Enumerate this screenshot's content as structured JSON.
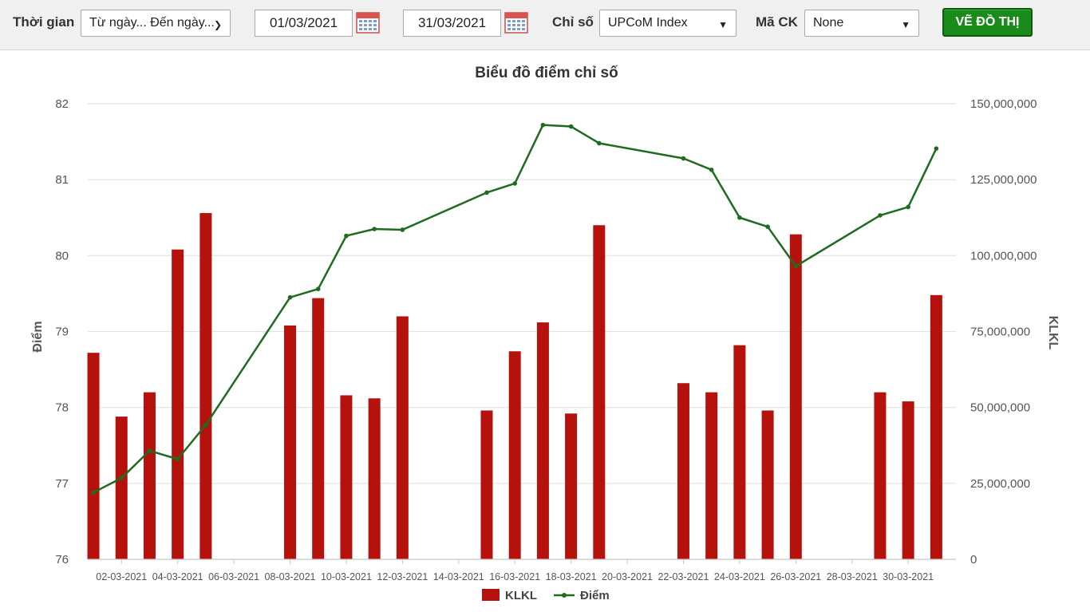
{
  "toolbar": {
    "time_label": "Thời gian",
    "time_range_value": "Từ ngày... Đến ngày...",
    "from_date": "01/03/2021",
    "to_date": "31/03/2021",
    "index_label": "Chỉ số",
    "index_value": "UPCoM Index",
    "stock_label": "Mã CK",
    "stock_value": "None",
    "draw_button": "VẼ ĐỒ THỊ"
  },
  "colors": {
    "bar": "#b5120e",
    "line": "#1f6b1f",
    "grid": "#e2e2e2",
    "axis_text": "#555555"
  },
  "chart_data": {
    "type": "bar",
    "title": "Biểu đồ điểm chỉ số",
    "ylabel_left": "Điểm",
    "ylabel_right": "KLKL",
    "y_left_range": [
      76,
      82
    ],
    "y_left_ticks": [
      "76",
      "77",
      "78",
      "79",
      "80",
      "81",
      "82"
    ],
    "y_right_range": [
      0,
      150000000
    ],
    "y_right_ticks": [
      "0",
      "25,000,000",
      "50,000,000",
      "75,000,000",
      "100,000,000",
      "125,000,000",
      "150,000,000"
    ],
    "x_tick_labels": [
      "02-03-2021",
      "04-03-2021",
      "06-03-2021",
      "08-03-2021",
      "10-03-2021",
      "12-03-2021",
      "14-03-2021",
      "16-03-2021",
      "18-03-2021",
      "20-03-2021",
      "22-03-2021",
      "24-03-2021",
      "26-03-2021",
      "28-03-2021",
      "30-03-2021"
    ],
    "x_tick_days": [
      2,
      4,
      6,
      8,
      10,
      12,
      14,
      16,
      18,
      20,
      22,
      24,
      26,
      28,
      30
    ],
    "x_day_range": [
      0.8,
      31.7
    ],
    "grid": true,
    "legend": "bottom",
    "series": [
      {
        "name": "KLKL",
        "kind": "bar",
        "axis": "right",
        "points": [
          {
            "x": "01-03-2021",
            "y": 68000000
          },
          {
            "x": "02-03-2021",
            "y": 47000000
          },
          {
            "x": "03-03-2021",
            "y": 55000000
          },
          {
            "x": "04-03-2021",
            "y": 102000000
          },
          {
            "x": "05-03-2021",
            "y": 114000000
          },
          {
            "x": "08-03-2021",
            "y": 77000000
          },
          {
            "x": "09-03-2021",
            "y": 86000000
          },
          {
            "x": "10-03-2021",
            "y": 54000000
          },
          {
            "x": "11-03-2021",
            "y": 53000000
          },
          {
            "x": "12-03-2021",
            "y": 80000000
          },
          {
            "x": "15-03-2021",
            "y": 49000000
          },
          {
            "x": "16-03-2021",
            "y": 68500000
          },
          {
            "x": "17-03-2021",
            "y": 78000000
          },
          {
            "x": "18-03-2021",
            "y": 48000000
          },
          {
            "x": "19-03-2021",
            "y": 110000000
          },
          {
            "x": "22-03-2021",
            "y": 58000000
          },
          {
            "x": "23-03-2021",
            "y": 55000000
          },
          {
            "x": "24-03-2021",
            "y": 70500000
          },
          {
            "x": "25-03-2021",
            "y": 49000000
          },
          {
            "x": "26-03-2021",
            "y": 107000000
          },
          {
            "x": "29-03-2021",
            "y": 55000000
          },
          {
            "x": "30-03-2021",
            "y": 52000000
          },
          {
            "x": "31-03-2021",
            "y": 87000000
          }
        ]
      },
      {
        "name": "Điểm",
        "kind": "line",
        "axis": "left",
        "points": [
          {
            "x": "01-03-2021",
            "y": 76.88
          },
          {
            "x": "02-03-2021",
            "y": 77.07
          },
          {
            "x": "03-03-2021",
            "y": 77.43
          },
          {
            "x": "04-03-2021",
            "y": 77.32
          },
          {
            "x": "05-03-2021",
            "y": 77.77
          },
          {
            "x": "08-03-2021",
            "y": 79.45
          },
          {
            "x": "09-03-2021",
            "y": 79.56
          },
          {
            "x": "10-03-2021",
            "y": 80.26
          },
          {
            "x": "11-03-2021",
            "y": 80.35
          },
          {
            "x": "12-03-2021",
            "y": 80.34
          },
          {
            "x": "15-03-2021",
            "y": 80.83
          },
          {
            "x": "16-03-2021",
            "y": 80.95
          },
          {
            "x": "17-03-2021",
            "y": 81.72
          },
          {
            "x": "18-03-2021",
            "y": 81.7
          },
          {
            "x": "19-03-2021",
            "y": 81.48
          },
          {
            "x": "22-03-2021",
            "y": 81.28
          },
          {
            "x": "23-03-2021",
            "y": 81.13
          },
          {
            "x": "24-03-2021",
            "y": 80.5
          },
          {
            "x": "25-03-2021",
            "y": 80.38
          },
          {
            "x": "26-03-2021",
            "y": 79.86
          },
          {
            "x": "29-03-2021",
            "y": 80.53
          },
          {
            "x": "30-03-2021",
            "y": 80.64
          },
          {
            "x": "31-03-2021",
            "y": 81.41
          }
        ]
      }
    ]
  }
}
